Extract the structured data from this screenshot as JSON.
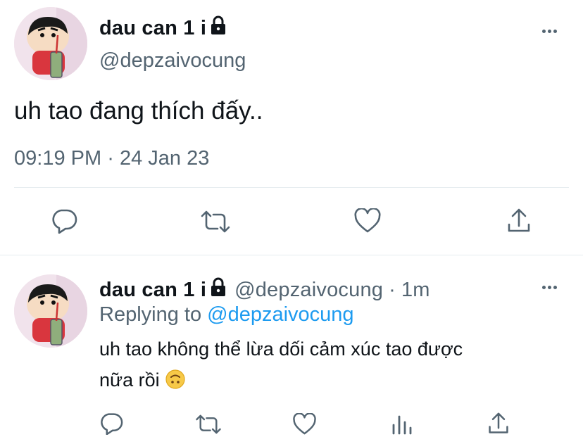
{
  "main_tweet": {
    "display_name": "dau can 1 i",
    "handle": "@depzaivocung",
    "text": "uh tao đang thích đấy..",
    "time": "09:19 PM",
    "separator": "·",
    "date": "24 Jan 23"
  },
  "actions": {
    "reply_icon": "reply-icon",
    "retweet_icon": "retweet-icon",
    "like_icon": "heart-icon",
    "share_icon": "share-icon",
    "views_icon": "views-icon"
  },
  "reply_tweet": {
    "display_name": "dau can 1 i",
    "handle": "@depzaivocung",
    "separator": "·",
    "age": "1m",
    "replying_prefix": "Replying to",
    "replying_handle": "@depzaivocung",
    "text_line1": "uh tao không thể lừa dối cảm xúc tao được",
    "text_line2": "nữa rồi",
    "emoji": "🙃"
  },
  "colors": {
    "text": "#0f1419",
    "secondary": "#536471",
    "link": "#1d9bf0",
    "divider": "#e6ecf0"
  }
}
